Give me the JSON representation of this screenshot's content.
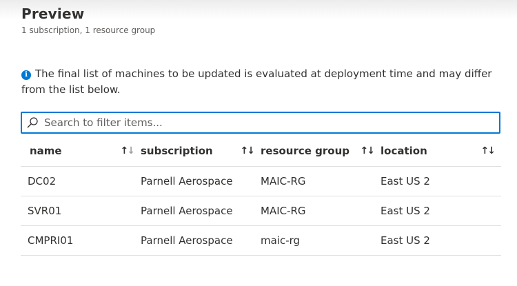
{
  "header": {
    "title": "Preview",
    "subtitle": "1 subscription, 1 resource group"
  },
  "info": {
    "icon": "info-icon",
    "text": "The final list of machines to be updated is evaluated at deployment time and may differ from the list below."
  },
  "search": {
    "icon": "search-icon",
    "placeholder": "Search to filter items...",
    "value": ""
  },
  "table": {
    "columns": [
      {
        "label": "name",
        "sort_icon": "sort-icon"
      },
      {
        "label": "subscription",
        "sort_icon": "sort-icon"
      },
      {
        "label": "resource group",
        "sort_icon": "sort-icon"
      },
      {
        "label": "location",
        "sort_icon": "sort-icon"
      }
    ],
    "rows": [
      {
        "name": "DC02",
        "subscription": "Parnell Aerospace",
        "resource_group": "MAIC-RG",
        "location": "East US 2"
      },
      {
        "name": "SVR01",
        "subscription": "Parnell Aerospace",
        "resource_group": "MAIC-RG",
        "location": "East US 2"
      },
      {
        "name": "CMPRI01",
        "subscription": "Parnell Aerospace",
        "resource_group": "maic-rg",
        "location": "East US 2"
      }
    ]
  },
  "colors": {
    "accent": "#0078d4",
    "text": "#323130",
    "muted": "#605e5c",
    "divider": "#e1dfdd"
  }
}
